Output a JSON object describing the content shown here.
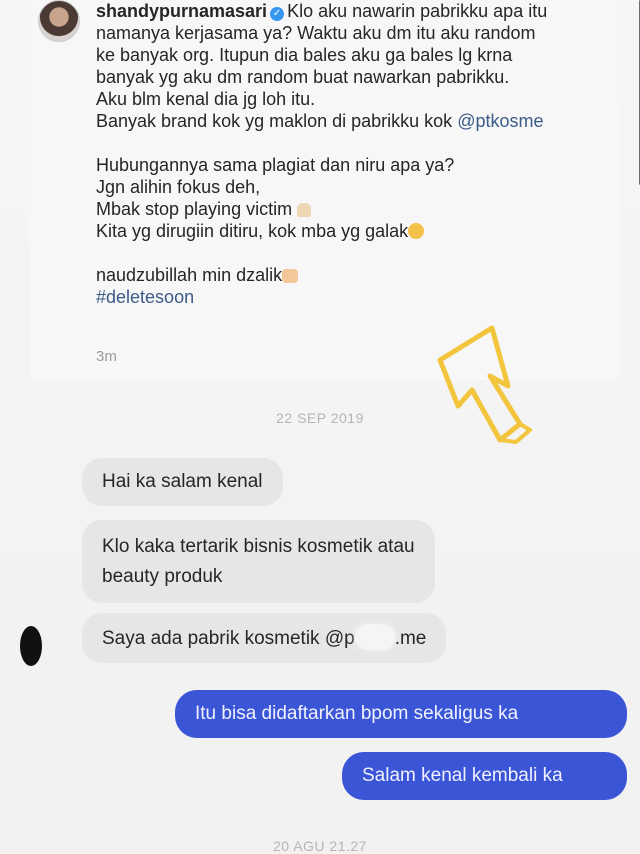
{
  "comment": {
    "username": "shandypurnamasari",
    "verified_badge": "verified-icon",
    "lines": [
      "Klo aku nawarin pabrikku apa itu",
      "namanya kerjasama ya? Waktu aku dm itu aku random",
      "ke banyak org. Itupun dia bales aku ga bales lg krna",
      "banyak yg aku dm random buat nawarkan pabrikku.",
      "Aku blm kenal dia jg loh itu.",
      "Banyak brand kok yg maklon di pabrikku kok "
    ],
    "mention": "@ptkosme",
    "lines2": [
      "Hubungannya sama plagiat dan niru apa ya?",
      "Jgn alihin fokus deh,",
      "Mbak stop playing victim ",
      "Kita yg dirugiin ditiru, kok mba yg galak"
    ],
    "closing": "naudzubillah min dzalik",
    "hashtag": "#deletesoon",
    "time_ago": "3m"
  },
  "chat": {
    "date_top": "22 SEP 2019",
    "incoming": [
      "Hai ka salam kenal",
      "Klo kaka tertarik bisnis kosmetik atau",
      "beauty produk",
      "Saya ada pabrik kosmetik @p",
      ".me"
    ],
    "outgoing": [
      "Itu bisa didaftarkan bpom sekaligus ka",
      "Salam kenal kembali ka"
    ],
    "date_bottom": "20 AGU 21.27"
  },
  "colors": {
    "outgoing_bubble": "#3a55d6",
    "incoming_bubble": "#e6e6e6",
    "arrow": "#f2c53d"
  }
}
